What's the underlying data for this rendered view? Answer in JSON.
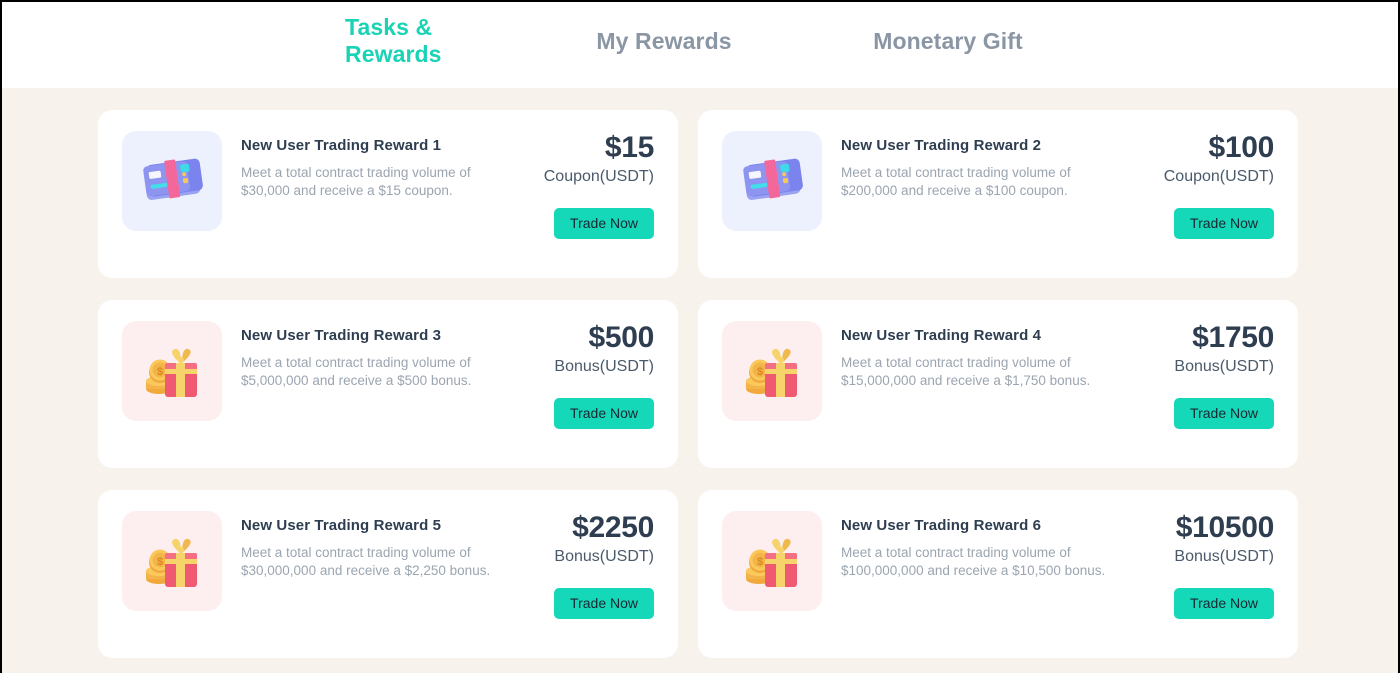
{
  "header": {
    "tabs": [
      {
        "label": "Tasks & Rewards",
        "active": true
      },
      {
        "label": "My Rewards",
        "active": false
      },
      {
        "label": "Monetary Gift",
        "active": false
      }
    ]
  },
  "theme": {
    "accent": "#14d8b8",
    "tab_active": "#19d3b5",
    "tab_inactive": "#8b96a5",
    "page_bg": "#f7f2ec",
    "card_bg": "#ffffff",
    "title_color": "#2e3e50",
    "desc_color": "#9ba5b0",
    "coupon_tile_bg": "#edf1fe",
    "gift_tile_bg": "#fdeff0"
  },
  "rewards": [
    {
      "icon": "coupon-icon",
      "icon_style": "coupon",
      "title": "New User Trading Reward 1",
      "description": "Meet a total contract trading volume of $30,000 and receive a $15 coupon.",
      "amount": "$15",
      "amount_label": "Coupon(USDT)",
      "button_label": "Trade Now"
    },
    {
      "icon": "coupon-icon",
      "icon_style": "coupon",
      "title": "New User Trading Reward 2",
      "description": "Meet a total contract trading volume of $200,000 and receive a $100 coupon.",
      "amount": "$100",
      "amount_label": "Coupon(USDT)",
      "button_label": "Trade Now"
    },
    {
      "icon": "gift-icon",
      "icon_style": "gift",
      "title": "New User Trading Reward 3",
      "description": "Meet a total contract trading volume of $5,000,000 and receive a $500 bonus.",
      "amount": "$500",
      "amount_label": "Bonus(USDT)",
      "button_label": "Trade Now"
    },
    {
      "icon": "gift-icon",
      "icon_style": "gift",
      "title": "New User Trading Reward 4",
      "description": "Meet a total contract trading volume of $15,000,000 and receive a $1,750 bonus.",
      "amount": "$1750",
      "amount_label": "Bonus(USDT)",
      "button_label": "Trade Now"
    },
    {
      "icon": "gift-icon",
      "icon_style": "gift",
      "title": "New User Trading Reward 5",
      "description": "Meet a total contract trading volume of $30,000,000 and receive a $2,250 bonus.",
      "amount": "$2250",
      "amount_label": "Bonus(USDT)",
      "button_label": "Trade Now"
    },
    {
      "icon": "gift-icon",
      "icon_style": "gift",
      "title": "New User Trading Reward 6",
      "description": "Meet a total contract trading volume of $100,000,000 and receive a $10,500 bonus.",
      "amount": "$10500",
      "amount_label": "Bonus(USDT)",
      "button_label": "Trade Now"
    }
  ]
}
